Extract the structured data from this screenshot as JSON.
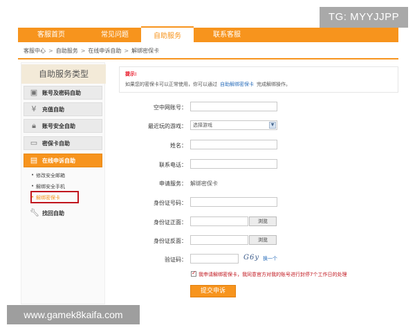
{
  "watermarks": {
    "top": "TG: MYYJJPP",
    "bottom": "www.gamek8kaifa.com"
  },
  "nav": {
    "items": [
      {
        "label": "客服首页",
        "active": false
      },
      {
        "label": "常见问题",
        "active": false
      },
      {
        "label": "自助服务",
        "active": true
      },
      {
        "label": "联系客服",
        "active": false
      }
    ]
  },
  "breadcrumb": [
    "客服中心",
    "自助服务",
    "在线申诉自助",
    "解绑密保卡"
  ],
  "breadcrumb_sep": ">",
  "sidebar": {
    "title": "自助服务类型",
    "items": [
      {
        "label": "账号及密码自助",
        "icon": "id-card-icon"
      },
      {
        "label": "充值自助",
        "icon": "yen-coin-icon"
      },
      {
        "label": "账号安全自助",
        "icon": "lock-icon"
      },
      {
        "label": "密保卡自助",
        "icon": "card-icon"
      },
      {
        "label": "在线申诉自助",
        "icon": "document-icon",
        "active": true
      },
      {
        "label": "找回自助",
        "icon": "wrench-icon"
      }
    ],
    "subitems": [
      "修改安全邮箱",
      "解绑安全手机",
      "解绑密保卡"
    ],
    "current_subitem": "解绑密保卡"
  },
  "notice": {
    "title": "提示:",
    "text_before": "如果您的密保卡可以正常使用，你可以通过",
    "link": "自助解绑密保卡",
    "text_after": "完成解绑操作。"
  },
  "form": {
    "account_label": "空中网账号：",
    "game_label": "最近玩的游戏：",
    "game_selected": "选择游戏",
    "name_label": "姓名：",
    "phone_label": "联系电话：",
    "service_label": "申请服务：",
    "service_value": "解绑密保卡",
    "idnum_label": "身份证号码：",
    "idfront_label": "身份证正面：",
    "idback_label": "身份证反面：",
    "browse_label": "浏览",
    "captcha_label": "验证码：",
    "captcha_text": "G6y",
    "captcha_refresh": "换一个",
    "agree_text": "我申请解绑密保卡，我同意官方对我的账号进行封停7个工作日的处理",
    "submit_label": "提交申诉"
  },
  "colors": {
    "accent": "#f7941d",
    "warning": "#c0141c",
    "link": "#2a6ebb"
  }
}
